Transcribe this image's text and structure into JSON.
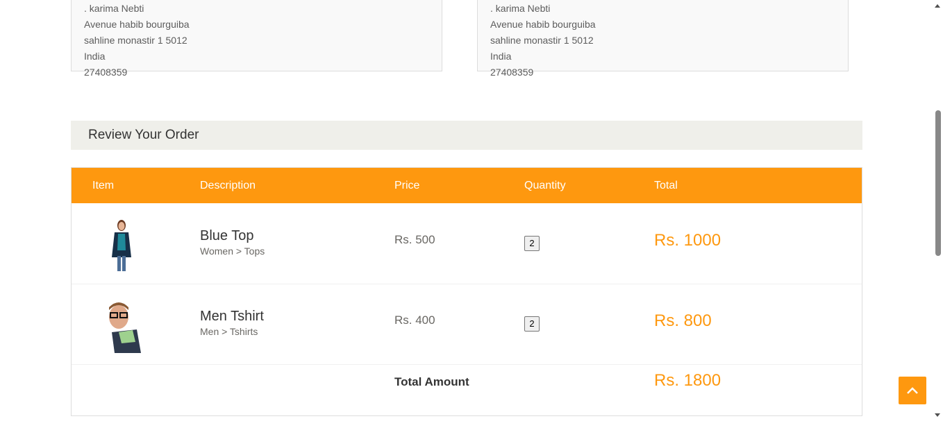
{
  "delivery_address": {
    "name": ". karima Nebti",
    "street": "Avenue habib bourguiba",
    "city_line": "sahline monastir 1 5012",
    "country": "India",
    "phone": "27408359"
  },
  "billing_address": {
    "name": ". karima Nebti",
    "street": "Avenue habib bourguiba",
    "city_line": "sahline monastir 1 5012",
    "country": "India",
    "phone": "27408359"
  },
  "review": {
    "heading": "Review Your Order",
    "columns": {
      "item": "Item",
      "description": "Description",
      "price": "Price",
      "quantity": "Quantity",
      "total": "Total"
    },
    "items": [
      {
        "name": "Blue Top",
        "category": "Women > Tops",
        "price": "Rs. 500",
        "quantity": "2",
        "total": "Rs. 1000",
        "image_icon": "woman-product-image"
      },
      {
        "name": "Men Tshirt",
        "category": "Men > Tshirts",
        "price": "Rs. 400",
        "quantity": "2",
        "total": "Rs. 800",
        "image_icon": "man-product-image"
      }
    ],
    "total_label": "Total Amount",
    "total_amount": "Rs. 1800"
  },
  "colors": {
    "accent": "#fe980f",
    "heading_bg": "#efefea"
  },
  "scroll_top_icon": "chevron-up-icon"
}
